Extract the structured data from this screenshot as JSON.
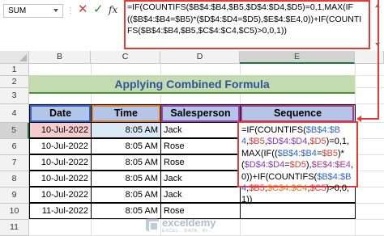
{
  "formula_bar": {
    "name_box": "SUM",
    "separator": "⋮",
    "cancel_glyph": "✕",
    "enter_glyph": "✓",
    "fx_label": "fx",
    "formula": "=IF(COUNTIFS($B$4:$B4,$B5,$D$4:$D4,$D5)=0,1,MAX(IF(($B$4:$B4=$B5)*($D$4:$D4=$D5),$E$4:$E4,0))+IF(COUNTIFS($B$4:$B4,$B5,$C$4:$C4,$C5)>0,0,1))"
  },
  "columns": [
    "A",
    "B",
    "C",
    "D",
    "E"
  ],
  "rows": [
    "1",
    "2",
    "3",
    "4",
    "5",
    "6",
    "7",
    "8",
    "9",
    "10",
    "11"
  ],
  "title": "Applying Combined Formula",
  "table": {
    "headers": [
      "Date",
      "Time",
      "Salesperson",
      "Sequence"
    ],
    "rows": [
      {
        "date": "10-Jul-2022",
        "time": "8:05 AM",
        "salesperson": "Jack"
      },
      {
        "date": "10-Jul-2022",
        "time": "8:05 AM",
        "salesperson": "Rose"
      },
      {
        "date": "10-Jul-2022",
        "time": "8:05 AM",
        "salesperson": "Rose"
      },
      {
        "date": "10-Jul-2022",
        "time": "8:05 AM",
        "salesperson": "Jack"
      },
      {
        "date": "10-Jul-2022",
        "time": "8:05 AM",
        "salesperson": "Jack"
      },
      {
        "date": "11-Jul-2022",
        "time": "8:05 AM",
        "salesperson": "Rose"
      }
    ]
  },
  "cell_edit": {
    "parts": [
      {
        "text": "=IF(COUNTIFS(",
        "color": "black"
      },
      {
        "text": "$B$4:$B4",
        "color": "blue"
      },
      {
        "text": ",",
        "color": "black"
      },
      {
        "text": "$B5",
        "color": "red"
      },
      {
        "text": ",",
        "color": "black"
      },
      {
        "text": "$D$4:$D4",
        "color": "purple"
      },
      {
        "text": ",",
        "color": "black"
      },
      {
        "text": "$D5",
        "color": "red"
      },
      {
        "text": ")=0,1,MAX(IF((",
        "color": "black"
      },
      {
        "text": "$B$4:$B4",
        "color": "blue"
      },
      {
        "text": "=",
        "color": "black"
      },
      {
        "text": "$B5",
        "color": "red"
      },
      {
        "text": ")*(",
        "color": "black"
      },
      {
        "text": "$D$4:$D4",
        "color": "purple"
      },
      {
        "text": "=",
        "color": "black"
      },
      {
        "text": "$D5",
        "color": "red"
      },
      {
        "text": "),",
        "color": "black"
      },
      {
        "text": "$E$4:$E4",
        "color": "magenta"
      },
      {
        "text": ",0))+IF(COUNTIFS(",
        "color": "black"
      },
      {
        "text": "$B$4:$B4",
        "color": "blue"
      },
      {
        "text": ",",
        "color": "black"
      },
      {
        "text": "$B5",
        "color": "red"
      },
      {
        "text": ",",
        "color": "black"
      },
      {
        "text": "$C$4:$C4",
        "color": "orange"
      },
      {
        "text": ",",
        "color": "black"
      },
      {
        "text": "$C5",
        "color": "red"
      },
      {
        "text": ")>0,0,1))",
        "color": "black"
      }
    ]
  },
  "watermark": {
    "name": "exceldemy",
    "tagline": "EXCEL · DATA · BI"
  },
  "colors": {
    "title_fill": "#c4dbb0",
    "title_text": "#2f5597",
    "header_fill": "#b4c6e7",
    "highlight_red": "#e53935",
    "ref_blue": "#2f65c9",
    "ref_orange": "#e07b2b",
    "ref_purple": "#a03ab5",
    "ref_magenta": "#b0378a"
  }
}
